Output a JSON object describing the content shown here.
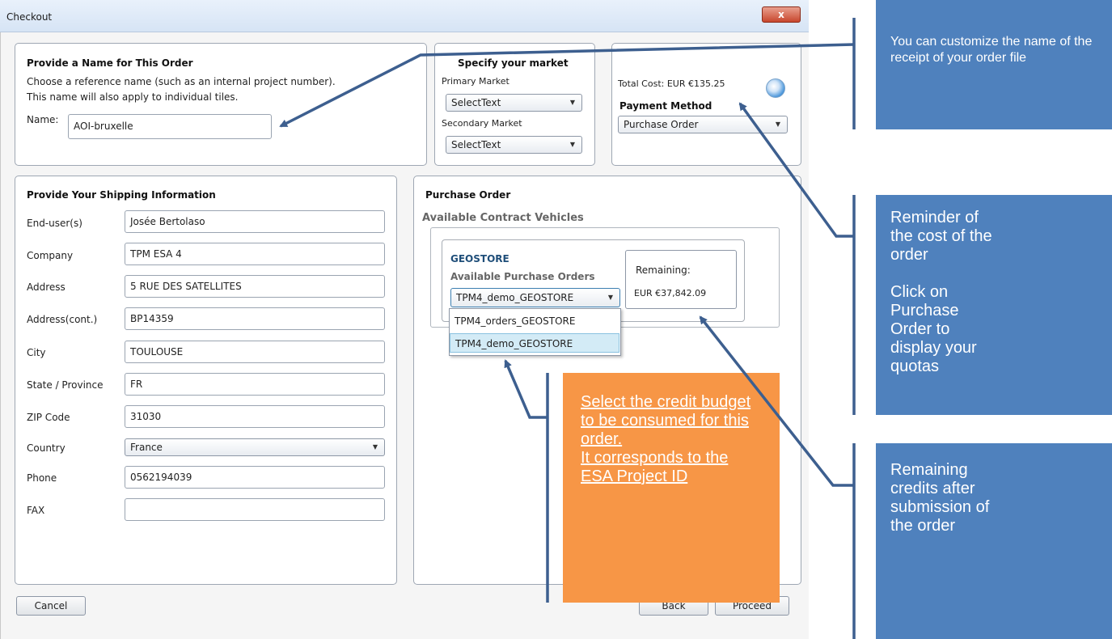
{
  "window": {
    "title": "Checkout",
    "close_glyph": "x"
  },
  "order_name": {
    "heading": "Provide a Name for This Order",
    "description1": "Choose a reference name (such as an internal project number).",
    "description2": "This name will also apply to individual tiles.",
    "name_label": "Name:",
    "name_value": "AOI-bruxelle"
  },
  "market": {
    "heading": "Specify your market",
    "primary_label": "Primary Market",
    "primary_value": "SelectText",
    "secondary_label": "Secondary Market",
    "secondary_value": "SelectText"
  },
  "cost": {
    "total_label": "Total Cost: EUR €135.25",
    "payment_label": "Payment Method",
    "payment_value": "Purchase Order"
  },
  "shipping": {
    "heading": "Provide Your Shipping Information",
    "fields": [
      {
        "label": "End-user(s)",
        "value": "Josée Bertolaso"
      },
      {
        "label": "Company",
        "value": "TPM ESA 4"
      },
      {
        "label": "Address",
        "value": "5 RUE DES SATELLITES"
      },
      {
        "label": "Address(cont.)",
        "value": "BP14359"
      },
      {
        "label": "City",
        "value": "TOULOUSE"
      },
      {
        "label": "State / Province",
        "value": "FR"
      },
      {
        "label": "ZIP Code",
        "value": "31030"
      },
      {
        "label": "Country",
        "value": "France"
      },
      {
        "label": "Phone",
        "value": "0562194039"
      },
      {
        "label": "FAX",
        "value": ""
      }
    ]
  },
  "purchase_order": {
    "heading": "Purchase Order",
    "subheading": "Available Contract Vehicles",
    "vendor": "GEOSTORE",
    "orders_label": "Available Purchase Orders",
    "selected": "TPM4_demo_GEOSTORE",
    "options": [
      "TPM4_orders_GEOSTORE",
      "TPM4_demo_GEOSTORE"
    ],
    "remaining_label": "Remaining:",
    "remaining_value": "EUR €37,842.09"
  },
  "buttons": {
    "cancel": "Cancel",
    "back": "Back",
    "proceed": "Proceed"
  },
  "callouts": {
    "name_tip": "You can customize the name of the receipt of your order file",
    "cost_tip_1": "Reminder of the cost of the order",
    "cost_tip_2": "Click on Purchase Order to display your quotas",
    "remaining_tip": "Remaining credits after submission of the order",
    "budget_tip_1": "Select the credit budget to be consumed for this order.",
    "budget_tip_2": "It corresponds to the ESA Project ID"
  },
  "colors": {
    "callout_blue": "#4f81bd",
    "callout_orange": "#f79646",
    "arrow": "#3d5f8f"
  }
}
